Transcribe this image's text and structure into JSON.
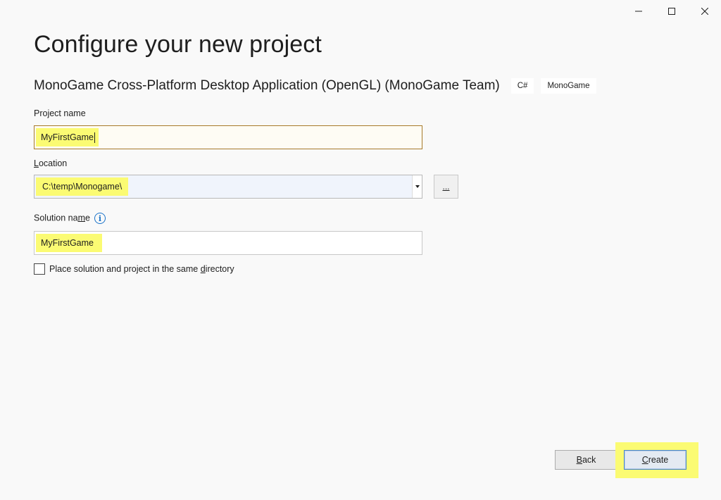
{
  "window": {
    "minimize_icon": "minimize-icon",
    "maximize_icon": "maximize-icon",
    "close_icon": "close-icon"
  },
  "page": {
    "title": "Configure your new project",
    "template_name": "MonoGame Cross-Platform Desktop Application (OpenGL) (MonoGame Team)",
    "tags": [
      "C#",
      "MonoGame"
    ]
  },
  "project_name": {
    "label": "Project name",
    "value": "MyFirstGame"
  },
  "location": {
    "label_accel": "L",
    "label_rest": "ocation",
    "value": "C:\\temp\\Monogame\\",
    "browse_label": "..."
  },
  "solution_name": {
    "label_pre": "Solution na",
    "label_accel": "m",
    "label_post": "e",
    "info_icon": "info-icon",
    "value": "MyFirstGame"
  },
  "same_directory": {
    "label_pre": "Place solution and project in the same ",
    "label_accel": "d",
    "label_post": "irectory",
    "checked": false
  },
  "buttons": {
    "back_accel": "B",
    "back_rest": "ack",
    "create_accel": "C",
    "create_rest": "reate"
  },
  "colors": {
    "highlight": "#fbfb73",
    "background": "#f9f9f9",
    "info_accent": "#1a73c9"
  }
}
